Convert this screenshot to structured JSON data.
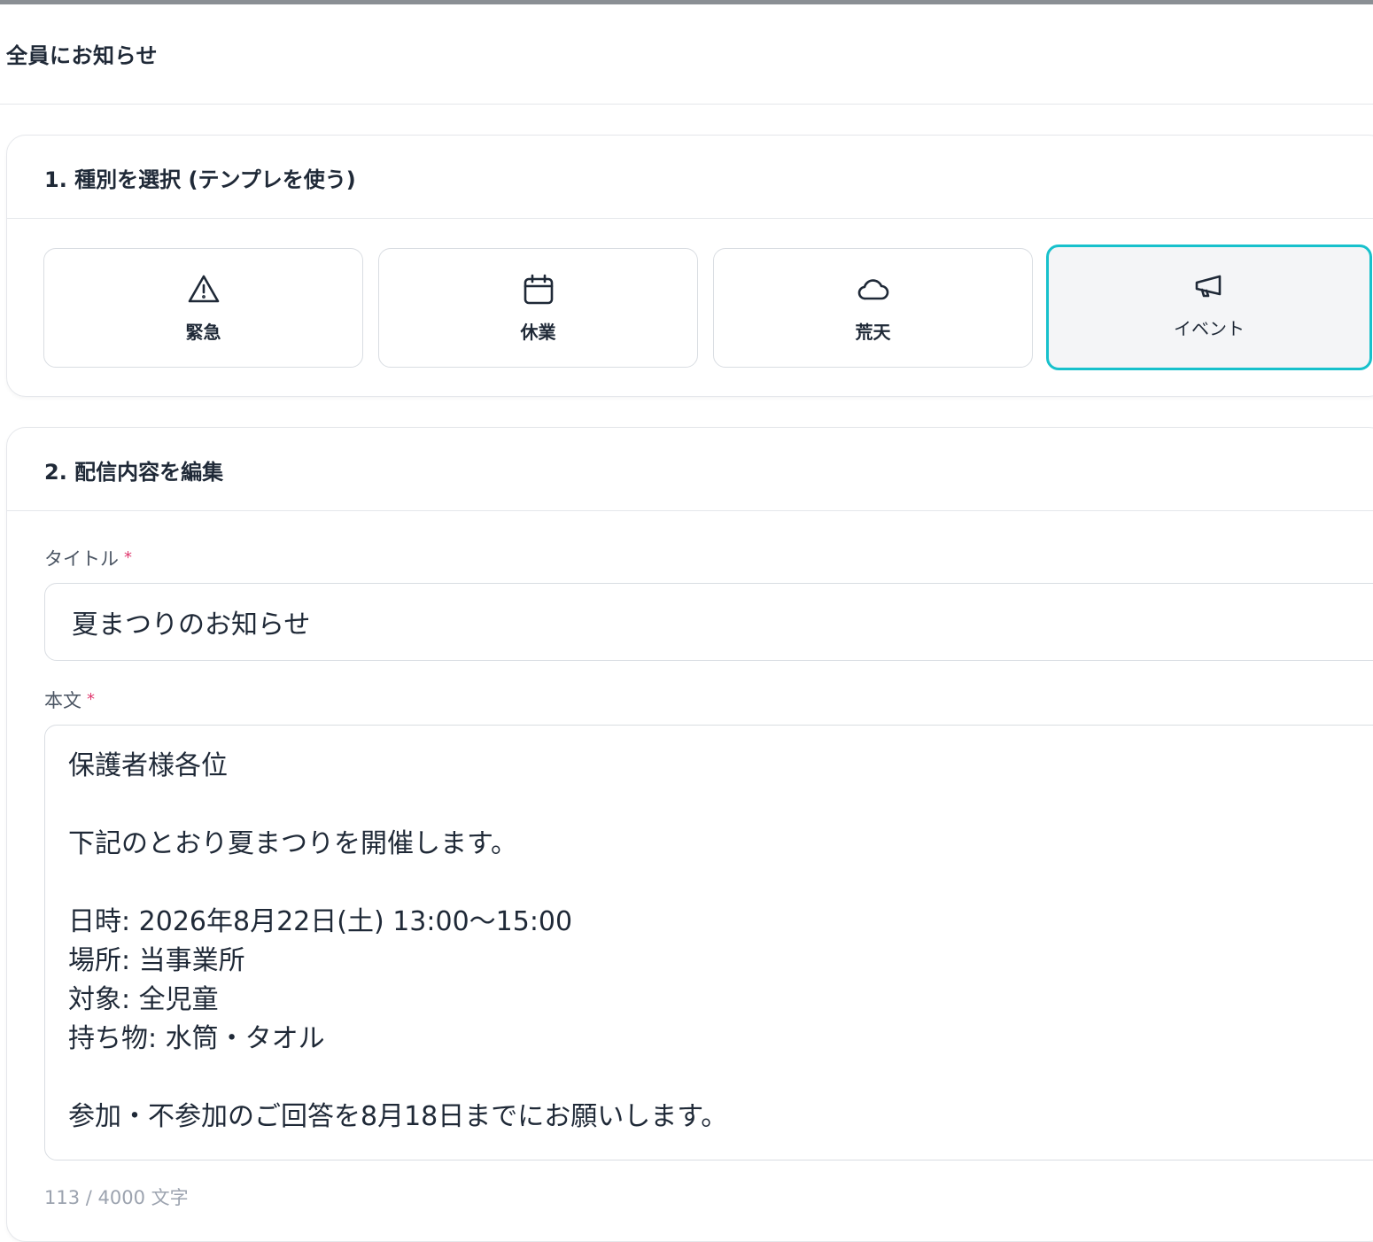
{
  "page": {
    "title": "全員にお知らせ"
  },
  "section1": {
    "title": "1. 種別を選択 (テンプレを使う)",
    "templates": [
      {
        "label": "緊急",
        "icon": "warning-triangle-icon",
        "selected": false
      },
      {
        "label": "休業",
        "icon": "calendar-icon",
        "selected": false
      },
      {
        "label": "荒天",
        "icon": "cloud-icon",
        "selected": false
      },
      {
        "label": "イベント",
        "icon": "megaphone-icon",
        "selected": true
      }
    ]
  },
  "section2": {
    "title": "2. 配信内容を編集",
    "title_field": {
      "label": "タイトル",
      "required_mark": "*",
      "value": "夏まつりのお知らせ"
    },
    "body_field": {
      "label": "本文",
      "required_mark": "*",
      "value": "保護者様各位\n\n下記のとおり夏まつりを開催します。\n\n日時: 2026年8月22日(土) 13:00〜15:00\n場所: 当事業所\n対象: 全児童\n持ち物: 水筒・タオル\n\n参加・不参加のご回答を8月18日までにお願いします。"
    },
    "char_count": "113 / 4000 文字"
  },
  "colors": {
    "accent": "#17c1cc",
    "required": "#e03a6f",
    "border": "#d9dde2"
  }
}
